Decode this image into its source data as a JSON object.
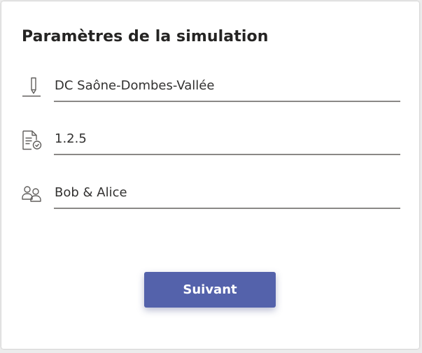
{
  "form": {
    "title": "Paramètres de la simulation",
    "fields": [
      {
        "icon": "pencil-icon",
        "value": "DC Saône-Dombes-Vallée"
      },
      {
        "icon": "document-check-icon",
        "value": "1.2.5"
      },
      {
        "icon": "people-icon",
        "value": "Bob & Alice"
      }
    ],
    "next_label": "Suivant"
  },
  "colors": {
    "button": "#5462ab",
    "underline": "#8a8886",
    "icon": "#605e5c"
  }
}
